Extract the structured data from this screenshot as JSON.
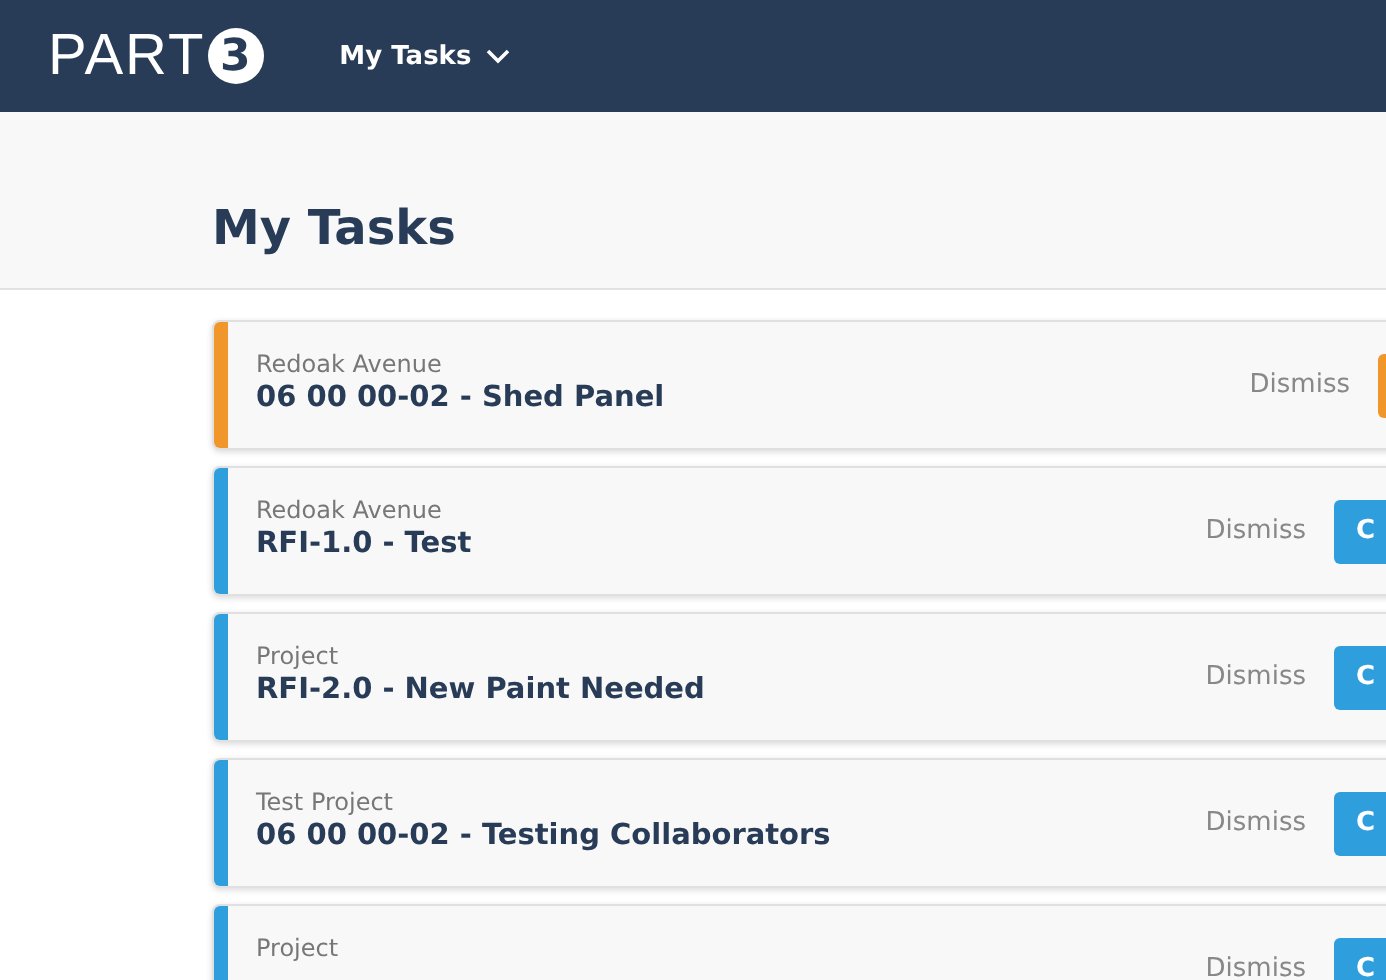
{
  "header": {
    "logo": "PART",
    "logo_mark": "3",
    "nav": "My Tasks"
  },
  "page_title": "My Tasks",
  "tasks": [
    {
      "project": "Redoak Avenue",
      "title": "06 00 00-02 - Shed Panel",
      "dismiss": "Dismiss",
      "color": "#f0962a"
    },
    {
      "project": "Redoak Avenue",
      "title": "RFI-1.0 - Test",
      "dismiss": "Dismiss",
      "action": "C",
      "color": "#2e9fdc"
    },
    {
      "project": "Project",
      "title": "RFI-2.0 - New Paint Needed",
      "dismiss": "Dismiss",
      "action": "C",
      "color": "#2e9fdc"
    },
    {
      "project": "Test Project",
      "title": "06 00 00-02 - Testing Collaborators",
      "dismiss": "Dismiss",
      "action": "C",
      "color": "#2e9fdc"
    },
    {
      "project": "Project",
      "dismiss": "Dismiss",
      "action": "C",
      "color": "#2e9fdc"
    }
  ]
}
